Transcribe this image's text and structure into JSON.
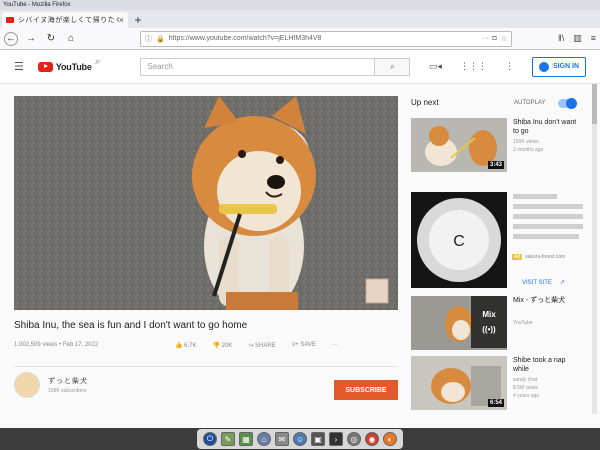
{
  "browser": {
    "window_title": "YouTube - Mozilla Firefox",
    "tab_title": "シバイヌ海が楽しくて帰りたくない",
    "tab_close": "×",
    "new_tab": "+",
    "url": "https://www.youtube.com/watch?v=jELHfM3h4V8",
    "icons": [
      "back-icon",
      "forward-icon",
      "reload-icon",
      "home-icon",
      "info-icon",
      "lock-icon",
      "pocket-icon",
      "star-icon",
      "library-icon",
      "sidebar-icon",
      "menu-icon"
    ]
  },
  "youtube": {
    "logo_text": "YouTube",
    "logo_region": "JP",
    "search_placeholder": "Search",
    "signin_label": "SIGN IN"
  },
  "video": {
    "title": "Shiba Inu, the sea is fun and I don't want to go home",
    "views": "1,002,509 views",
    "date": "Feb 17, 2022",
    "likes": "6.7K",
    "dislikes": "20K",
    "share": "SHARE",
    "save": "SAVE",
    "more": "···"
  },
  "channel": {
    "name": "ずっと柴犬",
    "subscribers": "109K subscribers",
    "subscribe_label": "SUBSCRIBE"
  },
  "sidebar": {
    "up_next": "Up next",
    "autoplay": "AUTOPLAY",
    "autoplay_on": true,
    "items": [
      {
        "title": "Shiba Inu don't want to go",
        "channel": "",
        "views": "155K views",
        "age": "2 months ago",
        "duration": "3:43"
      },
      {
        "ad_label": "Ad",
        "domain": "sakura-forest.com",
        "visit": "VISIT SITE"
      },
      {
        "title": "Mix - ずっと柴犬",
        "channel": "YouTube",
        "mix_label": "Mix"
      },
      {
        "title": "Shibe took a nap while",
        "channel": "sandy chat",
        "views": "8.5M views",
        "age": "4 years ago",
        "duration": "6:54"
      }
    ]
  },
  "taskbar": {
    "icons": [
      "power-icon",
      "editor-icon",
      "spreadsheet-icon",
      "files-icon",
      "mail-icon",
      "chat-icon",
      "media-icon",
      "terminal-icon",
      "network-icon",
      "wifi-icon",
      "firefox-icon"
    ]
  },
  "colors": {
    "youtube_red": "#e62117",
    "subscribe_orange": "#e25a2c",
    "link_blue": "#1a73e8"
  }
}
